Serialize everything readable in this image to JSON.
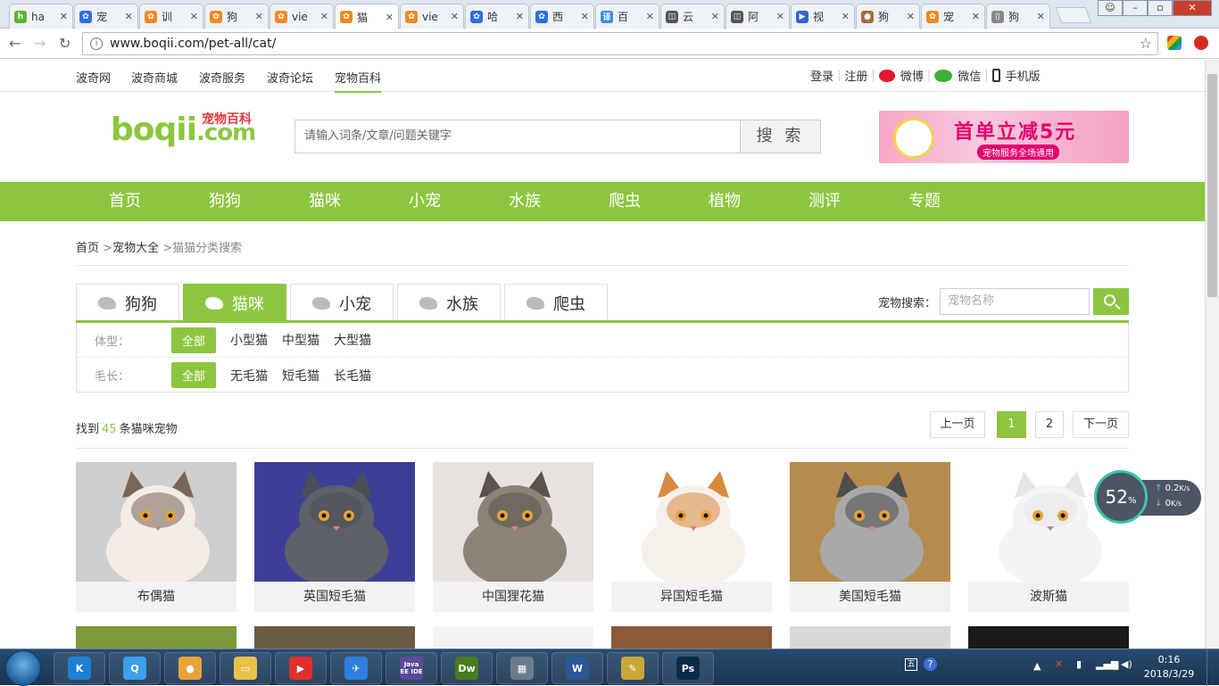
{
  "browser": {
    "tabs": [
      {
        "label": "ha",
        "icon": "hao123-icon",
        "color": "#5cb531"
      },
      {
        "label": "宠",
        "icon": "baidu-paw-icon",
        "color": "#2f6fe0"
      },
      {
        "label": "训",
        "icon": "paw-icon",
        "color": "#f08a24"
      },
      {
        "label": "狗",
        "icon": "paw-icon",
        "color": "#f08a24"
      },
      {
        "label": "vie",
        "icon": "paw-icon",
        "color": "#f08a24"
      },
      {
        "label": "猫",
        "icon": "paw-icon",
        "color": "#f08a24",
        "active": true
      },
      {
        "label": "vie",
        "icon": "paw-icon",
        "color": "#f08a24"
      },
      {
        "label": "哈",
        "icon": "baidu-paw-icon",
        "color": "#2f6fe0"
      },
      {
        "label": "西",
        "icon": "baidu-paw-icon",
        "color": "#2f6fe0"
      },
      {
        "label": "百",
        "icon": "translate-icon",
        "color": "#3a8ee6"
      },
      {
        "label": "云",
        "icon": "cloud-icon",
        "color": "#555555"
      },
      {
        "label": "阿",
        "icon": "cloud-icon",
        "color": "#555555"
      },
      {
        "label": "视",
        "icon": "video-icon",
        "color": "#3366cc"
      },
      {
        "label": "狗",
        "icon": "dog-icon",
        "color": "#a0703c"
      },
      {
        "label": "宠",
        "icon": "paw-icon",
        "color": "#f08a24"
      },
      {
        "label": "狗",
        "icon": "page-icon",
        "color": "#888888"
      }
    ],
    "url": "www.boqii.com/pet-all/cat/",
    "url_info_icon": "i"
  },
  "topbar": {
    "links": [
      "波奇网",
      "波奇商城",
      "波奇服务",
      "波奇论坛",
      "宠物百科"
    ],
    "current": "宠物百科",
    "login": "登录",
    "register": "注册",
    "weibo": "微博",
    "wechat": "微信",
    "mobile": "手机版"
  },
  "logo": {
    "brand": "boqii",
    "domain": ".com",
    "tagline": "宠物百科"
  },
  "search": {
    "placeholder": "请输入词条/文章/问题关键字",
    "button": "搜 索"
  },
  "banner": {
    "title": "首单立减5元",
    "subtitle": "宠物服务全场通用"
  },
  "mainnav": [
    "首页",
    "狗狗",
    "猫咪",
    "小宠",
    "水族",
    "爬虫",
    "植物",
    "测评",
    "专题"
  ],
  "breadcrumb": {
    "home": "首页",
    "sep": ">",
    "level1": "宠物大全",
    "current": "猫猫分类搜索"
  },
  "category_tabs": [
    {
      "label": "狗狗",
      "icon": "dog-icon"
    },
    {
      "label": "猫咪",
      "icon": "cat-icon",
      "active": true
    },
    {
      "label": "小宠",
      "icon": "hamster-icon"
    },
    {
      "label": "水族",
      "icon": "fish-icon"
    },
    {
      "label": "爬虫",
      "icon": "turtle-icon"
    }
  ],
  "pet_search": {
    "label": "宠物搜索：",
    "placeholder": "宠物名称"
  },
  "filters": {
    "size": {
      "label": "体型：",
      "options": [
        "全部",
        "小型猫",
        "中型猫",
        "大型猫"
      ],
      "selected": "全部"
    },
    "hair": {
      "label": "毛长：",
      "options": [
        "全部",
        "无毛猫",
        "短毛猫",
        "长毛猫"
      ],
      "selected": "全部"
    }
  },
  "results": {
    "prefix": "找到",
    "count": "45",
    "suffix": "条猫咪宠物"
  },
  "pager": {
    "prev": "上一页",
    "pages": [
      "1",
      "2"
    ],
    "current": "1",
    "next": "下一页"
  },
  "cats": [
    {
      "name": "布偶猫",
      "bg": "#cfcfcf",
      "fur": "#f3ece4",
      "mask": "#7a6658"
    },
    {
      "name": "英国短毛猫",
      "bg": "#3d3f96",
      "fur": "#5d6068",
      "mask": "#4b4e55"
    },
    {
      "name": "中国狸花猫",
      "bg": "#e6e2e0",
      "fur": "#8a8378",
      "mask": "#5b544c"
    },
    {
      "name": "异国短毛猫",
      "bg": "#ffffff",
      "fur": "#f5f0ea",
      "mask": "#d98a3f"
    },
    {
      "name": "美国短毛猫",
      "bg": "#b58c4e",
      "fur": "#a9a9a9",
      "mask": "#4d4d4d"
    },
    {
      "name": "波斯猫",
      "bg": "#ffffff",
      "fur": "#f4f4f4",
      "mask": "#e6e6e6"
    }
  ],
  "widget": {
    "percent": "52",
    "unit": "%",
    "up": "0.2",
    "down": "0",
    "rate_unit": "K/s"
  },
  "taskbar": {
    "apps": [
      {
        "name": "kugou-icon",
        "color": "#1f7ed8",
        "glyph": "K"
      },
      {
        "name": "browser-q-icon",
        "color": "#3aa0e8",
        "glyph": "Q"
      },
      {
        "name": "chrome-icon",
        "color": "#e8a33a",
        "glyph": "●"
      },
      {
        "name": "folder-icon",
        "color": "#e8c14a",
        "glyph": "▭"
      },
      {
        "name": "player-icon",
        "color": "#e0302a",
        "glyph": "▶"
      },
      {
        "name": "bird-icon",
        "color": "#2f7fe0",
        "glyph": "✈"
      },
      {
        "name": "javaee-icon",
        "color": "#5a4a9a",
        "glyph": "Java EE IDE"
      },
      {
        "name": "dreamweaver-icon",
        "color": "#4a7a1e",
        "glyph": "Dw"
      },
      {
        "name": "calculator-icon",
        "color": "#6b7b8c",
        "glyph": "▦"
      },
      {
        "name": "word-icon",
        "color": "#2b5797",
        "glyph": "W"
      },
      {
        "name": "paint-icon",
        "color": "#c9a83a",
        "glyph": "✎"
      },
      {
        "name": "photoshop-icon",
        "color": "#0a2a4a",
        "glyph": "Ps"
      }
    ],
    "time": "0:16",
    "date": "2018/3/29"
  }
}
